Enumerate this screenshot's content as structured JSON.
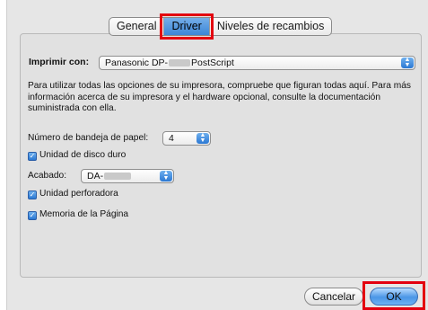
{
  "tabs": [
    {
      "label": "General",
      "selected": false
    },
    {
      "label": "Driver",
      "selected": true
    },
    {
      "label": "Niveles de recambios",
      "selected": false
    }
  ],
  "printer": {
    "label": "Imprimir con:",
    "value_prefix": "Panasonic DP-",
    "value_suffix": "PostScript"
  },
  "info_text": "Para utilizar todas las opciones de su impresora, compruebe que figuran todas aquí. Para más información acerca de su impresora y el hardware opcional, consulte la documentación suministrada con ella.",
  "paper_tray": {
    "label": "Número de bandeja de papel:",
    "value": "4"
  },
  "hard_disk": {
    "label": "Unidad de disco duro",
    "checked": true
  },
  "finisher": {
    "label": "Acabado:",
    "value_prefix": "DA-"
  },
  "puncher": {
    "label": "Unidad perforadora",
    "checked": true
  },
  "page_memory": {
    "label": "Memoria de la Página",
    "checked": true
  },
  "buttons": {
    "cancel": "Cancelar",
    "ok": "OK"
  },
  "colors": {
    "accent": "#3b86d8",
    "highlight": "#e3000f"
  }
}
